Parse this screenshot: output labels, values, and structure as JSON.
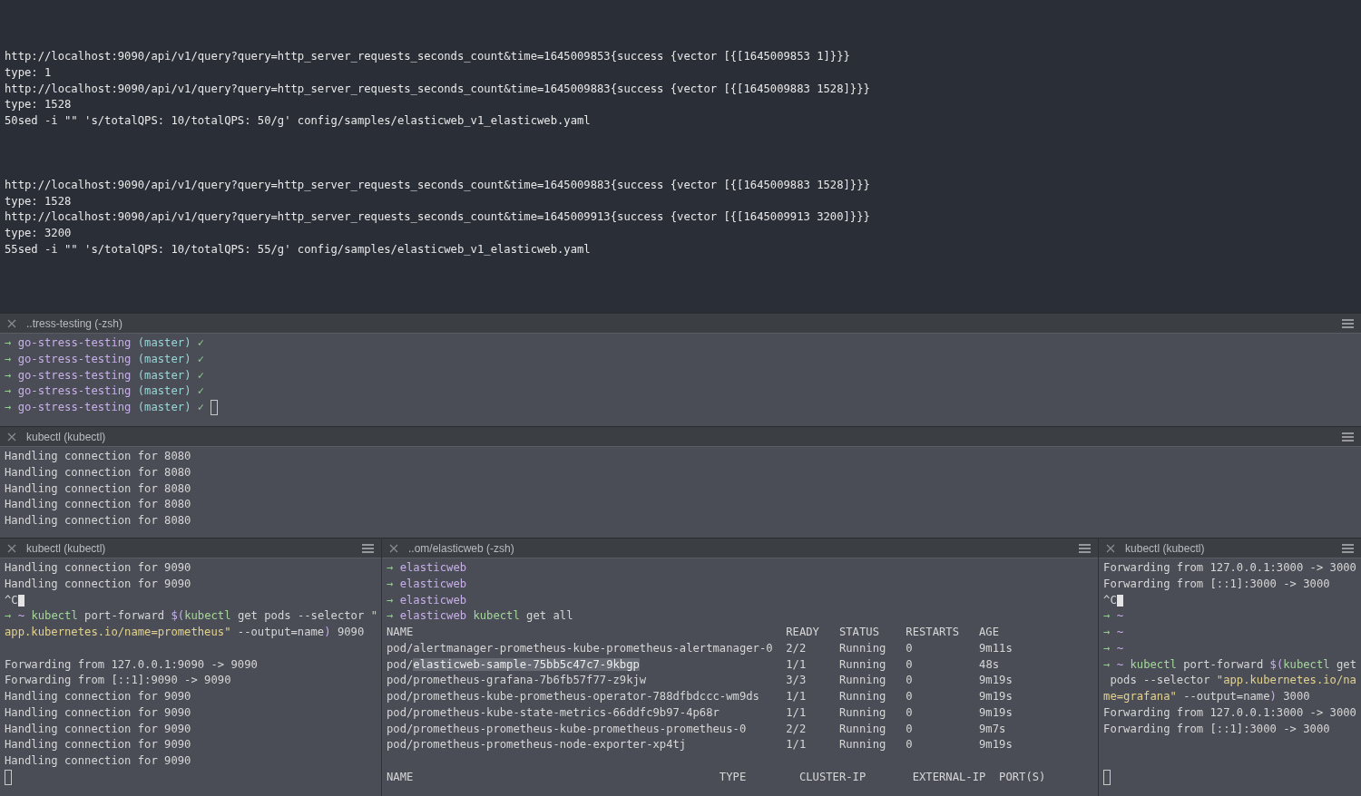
{
  "main_pane": {
    "blocks": [
      [
        {
          "segs": [
            {
              "kind": "text",
              "text": "http://localhost:9090/api/v1/query?query=http_server_requests_seconds_count&time=1645009853{success {vector [{[1645009853 1]}}}"
            }
          ]
        },
        {
          "segs": [
            {
              "kind": "text",
              "text": "type: 1"
            }
          ]
        },
        {
          "segs": [
            {
              "kind": "text",
              "text": "http://localhost:9090/api/v1/query?query=http_server_requests_seconds_count&time=1645009883{success {vector [{[1645009883 1528]}}}"
            }
          ]
        },
        {
          "segs": [
            {
              "kind": "text",
              "text": "type: 1528"
            }
          ]
        },
        {
          "segs": [
            {
              "kind": "text",
              "text": "50sed -i \"\" 's/totalQPS: 10/totalQPS: 50/g' config/samples/elasticweb_v1_elasticweb.yaml"
            }
          ]
        }
      ],
      [
        {
          "segs": [
            {
              "kind": "text",
              "text": "http://localhost:9090/api/v1/query?query=http_server_requests_seconds_count&time=1645009883{success {vector [{[1645009883 1528]}}}"
            }
          ]
        },
        {
          "segs": [
            {
              "kind": "text",
              "text": "type: 1528"
            }
          ]
        },
        {
          "segs": [
            {
              "kind": "text",
              "text": "http://localhost:9090/api/v1/query?query=http_server_requests_seconds_count&time=1645009913{success {vector [{[1645009913 3200]}}}"
            }
          ]
        },
        {
          "segs": [
            {
              "kind": "text",
              "text": "type: 3200"
            }
          ]
        },
        {
          "segs": [
            {
              "kind": "text",
              "text": "55sed -i \"\" 's/totalQPS: 10/totalQPS: 55/g' config/samples/elasticweb_v1_elasticweb.yaml"
            }
          ]
        }
      ]
    ]
  },
  "panes": [
    {
      "title": "..tress-testing (-zsh)",
      "blocks": [
        [
          {
            "segs": [
              {
                "kind": "arrow",
                "text": "→ "
              },
              {
                "kind": "dir",
                "text": "go-stress-testing "
              },
              {
                "kind": "branch",
                "text": "(master) "
              },
              {
                "kind": "ok",
                "text": "✓"
              }
            ]
          },
          {
            "segs": [
              {
                "kind": "arrow",
                "text": "→ "
              },
              {
                "kind": "dir",
                "text": "go-stress-testing "
              },
              {
                "kind": "branch",
                "text": "(master) "
              },
              {
                "kind": "ok",
                "text": "✓"
              }
            ]
          },
          {
            "segs": [
              {
                "kind": "arrow",
                "text": "→ "
              },
              {
                "kind": "dir",
                "text": "go-stress-testing "
              },
              {
                "kind": "branch",
                "text": "(master) "
              },
              {
                "kind": "ok",
                "text": "✓"
              }
            ]
          },
          {
            "segs": [
              {
                "kind": "arrow",
                "text": "→ "
              },
              {
                "kind": "dir",
                "text": "go-stress-testing "
              },
              {
                "kind": "branch",
                "text": "(master) "
              },
              {
                "kind": "ok",
                "text": "✓"
              }
            ]
          },
          {
            "segs": [
              {
                "kind": "arrow",
                "text": "→ "
              },
              {
                "kind": "dir",
                "text": "go-stress-testing "
              },
              {
                "kind": "branch",
                "text": "(master) "
              },
              {
                "kind": "ok",
                "text": "✓"
              }
            ],
            "cursor": true,
            "cursor_filled": false
          }
        ]
      ]
    },
    {
      "title": "kubectl (kubectl)",
      "blocks": [
        [
          {
            "segs": [
              {
                "kind": "text",
                "text": "Handling connection for 8080"
              }
            ]
          },
          {
            "segs": [
              {
                "kind": "text",
                "text": "Handling connection for 8080"
              }
            ]
          },
          {
            "segs": [
              {
                "kind": "text",
                "text": "Handling connection for 8080"
              }
            ]
          },
          {
            "segs": [
              {
                "kind": "text",
                "text": "Handling connection for 8080"
              }
            ]
          },
          {
            "segs": [
              {
                "kind": "text",
                "text": "Handling connection for 8080"
              }
            ]
          }
        ]
      ]
    }
  ],
  "bottom_panes": [
    {
      "title": "kubectl (kubectl)",
      "blocks": [
        [
          {
            "segs": [
              {
                "kind": "text",
                "text": "Handling connection for 9090"
              }
            ]
          },
          {
            "segs": [
              {
                "kind": "text",
                "text": "Handling connection for 9090"
              }
            ]
          },
          {
            "segs": [
              {
                "kind": "text",
                "text": "^C"
              }
            ],
            "cursor": true,
            "cursor_filled": true
          },
          {
            "segs": [
              {
                "kind": "arrow",
                "text": "→ "
              },
              {
                "kind": "dir",
                "text": "~ "
              },
              {
                "kind": "cmd",
                "text": "kubectl"
              },
              {
                "kind": "text",
                "text": " port-forward "
              },
              {
                "kind": "dir",
                "text": "$("
              },
              {
                "kind": "cmd",
                "text": "kubectl"
              },
              {
                "kind": "text",
                "text": " get pods --selector "
              },
              {
                "kind": "str",
                "text": "\""
              }
            ]
          },
          {
            "segs": [
              {
                "kind": "str",
                "text": "app.kubernetes.io/name=prometheus\""
              },
              {
                "kind": "text",
                "text": " --output=name"
              },
              {
                "kind": "dir",
                "text": ")"
              },
              {
                "kind": "text",
                "text": " 9090"
              }
            ]
          }
        ],
        [
          {
            "segs": [
              {
                "kind": "text",
                "text": "Forwarding from 127.0.0.1:9090 -> 9090"
              }
            ]
          },
          {
            "segs": [
              {
                "kind": "text",
                "text": "Forwarding from [::1]:9090 -> 9090"
              }
            ]
          },
          {
            "segs": [
              {
                "kind": "text",
                "text": "Handling connection for 9090"
              }
            ]
          },
          {
            "segs": [
              {
                "kind": "text",
                "text": "Handling connection for 9090"
              }
            ]
          },
          {
            "segs": [
              {
                "kind": "text",
                "text": "Handling connection for 9090"
              }
            ]
          },
          {
            "segs": [
              {
                "kind": "text",
                "text": "Handling connection for 9090"
              }
            ]
          },
          {
            "segs": [
              {
                "kind": "text",
                "text": "Handling connection for 9090"
              }
            ]
          },
          {
            "cursor": true,
            "cursor_filled": false
          }
        ]
      ]
    },
    {
      "title": "..om/elasticweb (-zsh)",
      "blocks": [
        [
          {
            "segs": [
              {
                "kind": "arrow",
                "text": "→ "
              },
              {
                "kind": "dir",
                "text": "elasticweb"
              }
            ]
          },
          {
            "segs": [
              {
                "kind": "arrow",
                "text": "→ "
              },
              {
                "kind": "dir",
                "text": "elasticweb"
              }
            ]
          },
          {
            "segs": [
              {
                "kind": "arrow",
                "text": "→ "
              },
              {
                "kind": "dir",
                "text": "elasticweb"
              }
            ]
          },
          {
            "segs": [
              {
                "kind": "arrow",
                "text": "→ "
              },
              {
                "kind": "dir",
                "text": "elasticweb "
              },
              {
                "kind": "cmd",
                "text": "kubectl"
              },
              {
                "kind": "text",
                "text": " get all"
              }
            ]
          },
          {
            "segs": [
              {
                "kind": "text",
                "text": "NAME                                                        READY   STATUS    RESTARTS   AGE"
              }
            ]
          },
          {
            "segs": [
              {
                "kind": "text",
                "text": "pod/alertmanager-prometheus-kube-prometheus-alertmanager-0  2/2     Running   0          9m11s"
              }
            ]
          },
          {
            "segs": [
              {
                "kind": "text",
                "text": "pod/"
              },
              {
                "kind": "sel",
                "text": "elasticweb-sample-75bb5c47c7-9kbgp"
              },
              {
                "kind": "text",
                "text": "                      1/1     Running   0          48s"
              }
            ]
          },
          {
            "segs": [
              {
                "kind": "text",
                "text": "pod/prometheus-grafana-7b6fb57f77-z9kjw                     3/3     Running   0          9m19s"
              }
            ]
          },
          {
            "segs": [
              {
                "kind": "text",
                "text": "pod/prometheus-kube-prometheus-operator-788dfbdccc-wm9ds    1/1     Running   0          9m19s"
              }
            ]
          },
          {
            "segs": [
              {
                "kind": "text",
                "text": "pod/prometheus-kube-state-metrics-66ddfc9b97-4p68r          1/1     Running   0          9m19s"
              }
            ]
          },
          {
            "segs": [
              {
                "kind": "text",
                "text": "pod/prometheus-prometheus-kube-prometheus-prometheus-0      2/2     Running   0          9m7s"
              }
            ]
          },
          {
            "segs": [
              {
                "kind": "text",
                "text": "pod/prometheus-prometheus-node-exporter-xp4tj               1/1     Running   0          9m19s"
              }
            ]
          }
        ],
        [
          {
            "segs": [
              {
                "kind": "text",
                "text": "NAME                                              TYPE        CLUSTER-IP       EXTERNAL-IP  PORT(S)"
              }
            ]
          }
        ]
      ]
    },
    {
      "title": "kubectl (kubectl)",
      "blocks": [
        [
          {
            "segs": [
              {
                "kind": "text",
                "text": "Forwarding from 127.0.0.1:3000 -> 3000"
              }
            ]
          },
          {
            "segs": [
              {
                "kind": "text",
                "text": "Forwarding from [::1]:3000 -> 3000"
              }
            ]
          },
          {
            "segs": [
              {
                "kind": "text",
                "text": "^C"
              }
            ],
            "cursor": true,
            "cursor_filled": true
          },
          {
            "segs": [
              {
                "kind": "arrow",
                "text": "→ "
              },
              {
                "kind": "dir",
                "text": "~"
              }
            ]
          },
          {
            "segs": [
              {
                "kind": "arrow",
                "text": "→ "
              },
              {
                "kind": "dir",
                "text": "~"
              }
            ]
          },
          {
            "segs": [
              {
                "kind": "arrow",
                "text": "→ "
              },
              {
                "kind": "dir",
                "text": "~"
              }
            ]
          },
          {
            "segs": [
              {
                "kind": "arrow",
                "text": "→ "
              },
              {
                "kind": "dir",
                "text": "~ "
              },
              {
                "kind": "cmd",
                "text": "kubectl"
              },
              {
                "kind": "text",
                "text": " port-forward "
              },
              {
                "kind": "dir",
                "text": "$("
              },
              {
                "kind": "cmd",
                "text": "kubectl"
              },
              {
                "kind": "text",
                "text": " get"
              }
            ]
          },
          {
            "segs": [
              {
                "kind": "text",
                "text": " pods --selector "
              },
              {
                "kind": "str",
                "text": "\"app.kubernetes.io/na"
              }
            ]
          },
          {
            "segs": [
              {
                "kind": "str",
                "text": "me=grafana\""
              },
              {
                "kind": "text",
                "text": " --output=name"
              },
              {
                "kind": "dir",
                "text": ")"
              },
              {
                "kind": "text",
                "text": " 3000"
              }
            ]
          },
          {
            "segs": [
              {
                "kind": "text",
                "text": "Forwarding from 127.0.0.1:3000 -> 3000"
              }
            ]
          },
          {
            "segs": [
              {
                "kind": "text",
                "text": "Forwarding from [::1]:3000 -> 3000"
              }
            ]
          }
        ],
        [
          {
            "cursor": true,
            "cursor_filled": false
          }
        ]
      ]
    }
  ]
}
